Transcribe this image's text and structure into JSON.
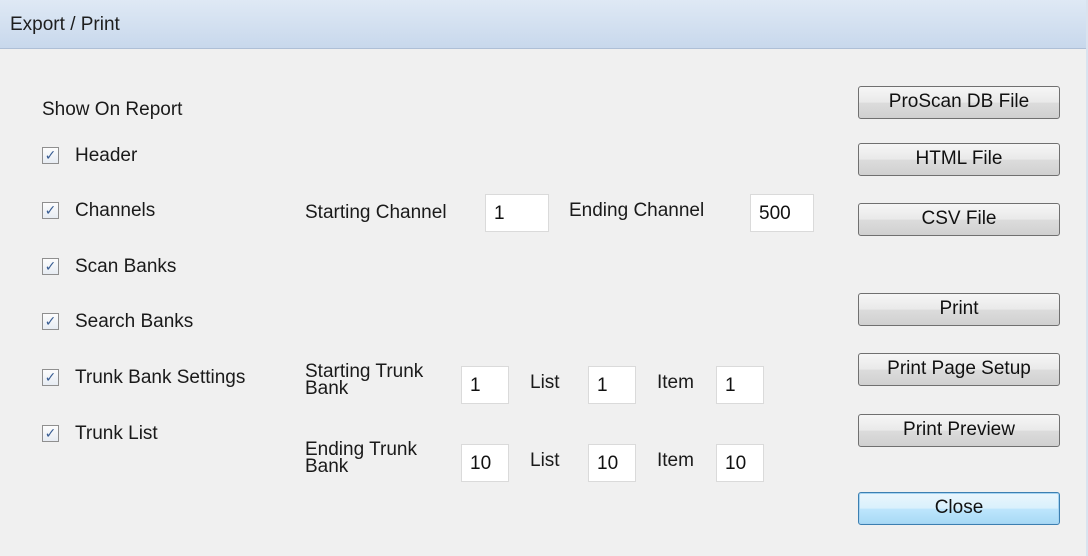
{
  "window": {
    "title": "Export / Print"
  },
  "show_on_report": {
    "heading": "Show On Report",
    "items": [
      {
        "label": "Header",
        "checked": true
      },
      {
        "label": "Channels",
        "checked": true
      },
      {
        "label": "Scan Banks",
        "checked": true
      },
      {
        "label": "Search Banks",
        "checked": true
      },
      {
        "label": "Trunk Bank Settings",
        "checked": true
      },
      {
        "label": "Trunk List",
        "checked": true
      }
    ]
  },
  "channels": {
    "starting_label": "Starting Channel",
    "starting_value": "1",
    "ending_label": "Ending Channel",
    "ending_value": "500"
  },
  "trunk": {
    "starting_label": "Starting Trunk Bank",
    "starting_bank": "1",
    "starting_list_label": "List",
    "starting_list": "1",
    "starting_item_label": "Item",
    "starting_item": "1",
    "ending_label": "Ending Trunk Bank",
    "ending_bank": "10",
    "ending_list_label": "List",
    "ending_list": "10",
    "ending_item_label": "Item",
    "ending_item": "10"
  },
  "buttons": {
    "proscan_db": "ProScan DB File",
    "html": "HTML File",
    "csv": "CSV File",
    "print": "Print",
    "print_page_setup": "Print Page Setup",
    "print_preview": "Print Preview",
    "close": "Close"
  },
  "checkmark_glyph": "✓",
  "colors": {
    "titlebar": "#c8d8ec",
    "dialog_bg": "#f0f0f0",
    "check": "#3a5e93"
  }
}
